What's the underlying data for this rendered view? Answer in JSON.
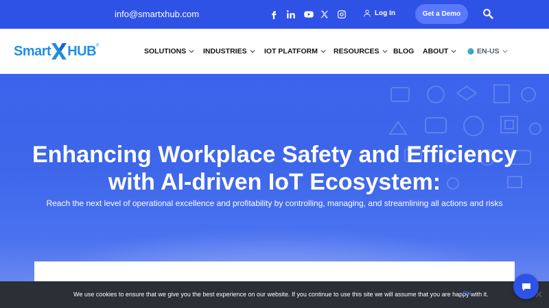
{
  "topbar": {
    "email": "info@smartxhub.com",
    "social": [
      "facebook-icon",
      "linkedin-icon",
      "youtube-icon",
      "x-twitter-icon",
      "instagram-icon"
    ],
    "login_label": "Log In",
    "demo_label": "Get a Demo"
  },
  "logo": {
    "smart": "Smart",
    "hub": "HUB",
    "reg": "®"
  },
  "nav": {
    "items": [
      {
        "label": "SOLUTIONS",
        "dropdown": true
      },
      {
        "label": "INDUSTRIES",
        "dropdown": true
      },
      {
        "label": "IOT PLATFORM",
        "dropdown": true
      },
      {
        "label": "RESOURCES",
        "dropdown": true
      },
      {
        "label": "BLOG",
        "dropdown": false
      },
      {
        "label": "ABOUT",
        "dropdown": true
      }
    ],
    "language": "EN-US"
  },
  "hero": {
    "title_line1": "Enhancing Workplace Safety and Efficiency",
    "title_line2": "with AI-driven IoT Ecosystem:",
    "subtitle": "Reach the next level of operational excellence and profitability by controlling, managing, and streamlining all actions and risks"
  },
  "cookie": {
    "message": "We use cookies to ensure that we give you the best experience on our website. If you continue to use this site we will assume that you are happy with it.",
    "ok_label": "OK"
  },
  "colors": {
    "topbar": "#2f52e6",
    "brand": "#1f8fe6",
    "hero": "#3d66ea",
    "cookie_bg": "#2b2f36"
  }
}
